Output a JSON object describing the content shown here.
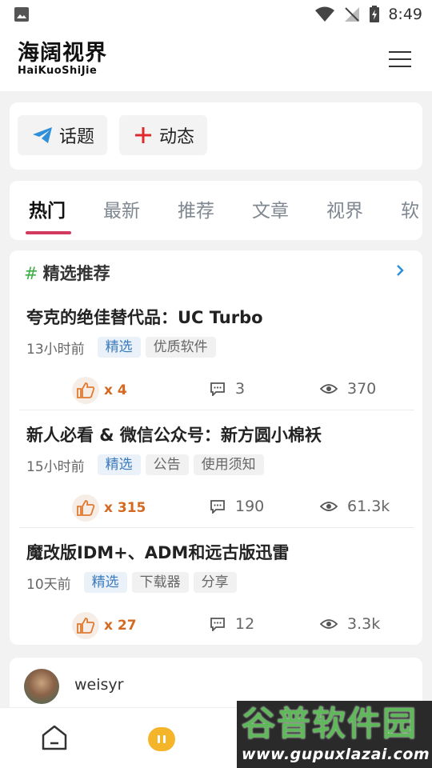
{
  "status_bar": {
    "time": "8:49"
  },
  "header": {
    "logo_cn": "海阔视界",
    "logo_en": "HaiKuoShiJie"
  },
  "actions": [
    {
      "label": "话题",
      "icon": "paper-plane-icon"
    },
    {
      "label": "动态",
      "icon": "plus-icon"
    }
  ],
  "tabs": [
    "热门",
    "最新",
    "推荐",
    "文章",
    "视界",
    "软"
  ],
  "featured": {
    "title": "精选推荐",
    "hash": "#",
    "posts": [
      {
        "title": "夸克的绝佳替代品：UC Turbo",
        "time": "13小时前",
        "tags": [
          "精选",
          "优质软件"
        ],
        "likes": "x 4",
        "comments": "3",
        "views": "370"
      },
      {
        "title": "新人必看 & 微信公众号：新方圆小棉袄",
        "time": "15小时前",
        "tags": [
          "精选",
          "公告",
          "使用须知"
        ],
        "likes": "x 315",
        "comments": "190",
        "views": "61.3k"
      },
      {
        "title": "魔改版IDM+、ADM和远古版迅雷",
        "time": "10天前",
        "tags": [
          "精选",
          "下载器",
          "分享"
        ],
        "likes": "x 27",
        "comments": "12",
        "views": "3.3k"
      }
    ]
  },
  "user_post": {
    "username": "weisyr"
  },
  "watermark": {
    "cn": "谷普软件园",
    "url": "www.gupuxlazai.com"
  },
  "colors": {
    "accent": "#d23a5f",
    "like": "#d46a22",
    "tag_blue": "#3b7bbf",
    "hash_green": "#3cb043",
    "nav_mid": "#f5b52a"
  }
}
